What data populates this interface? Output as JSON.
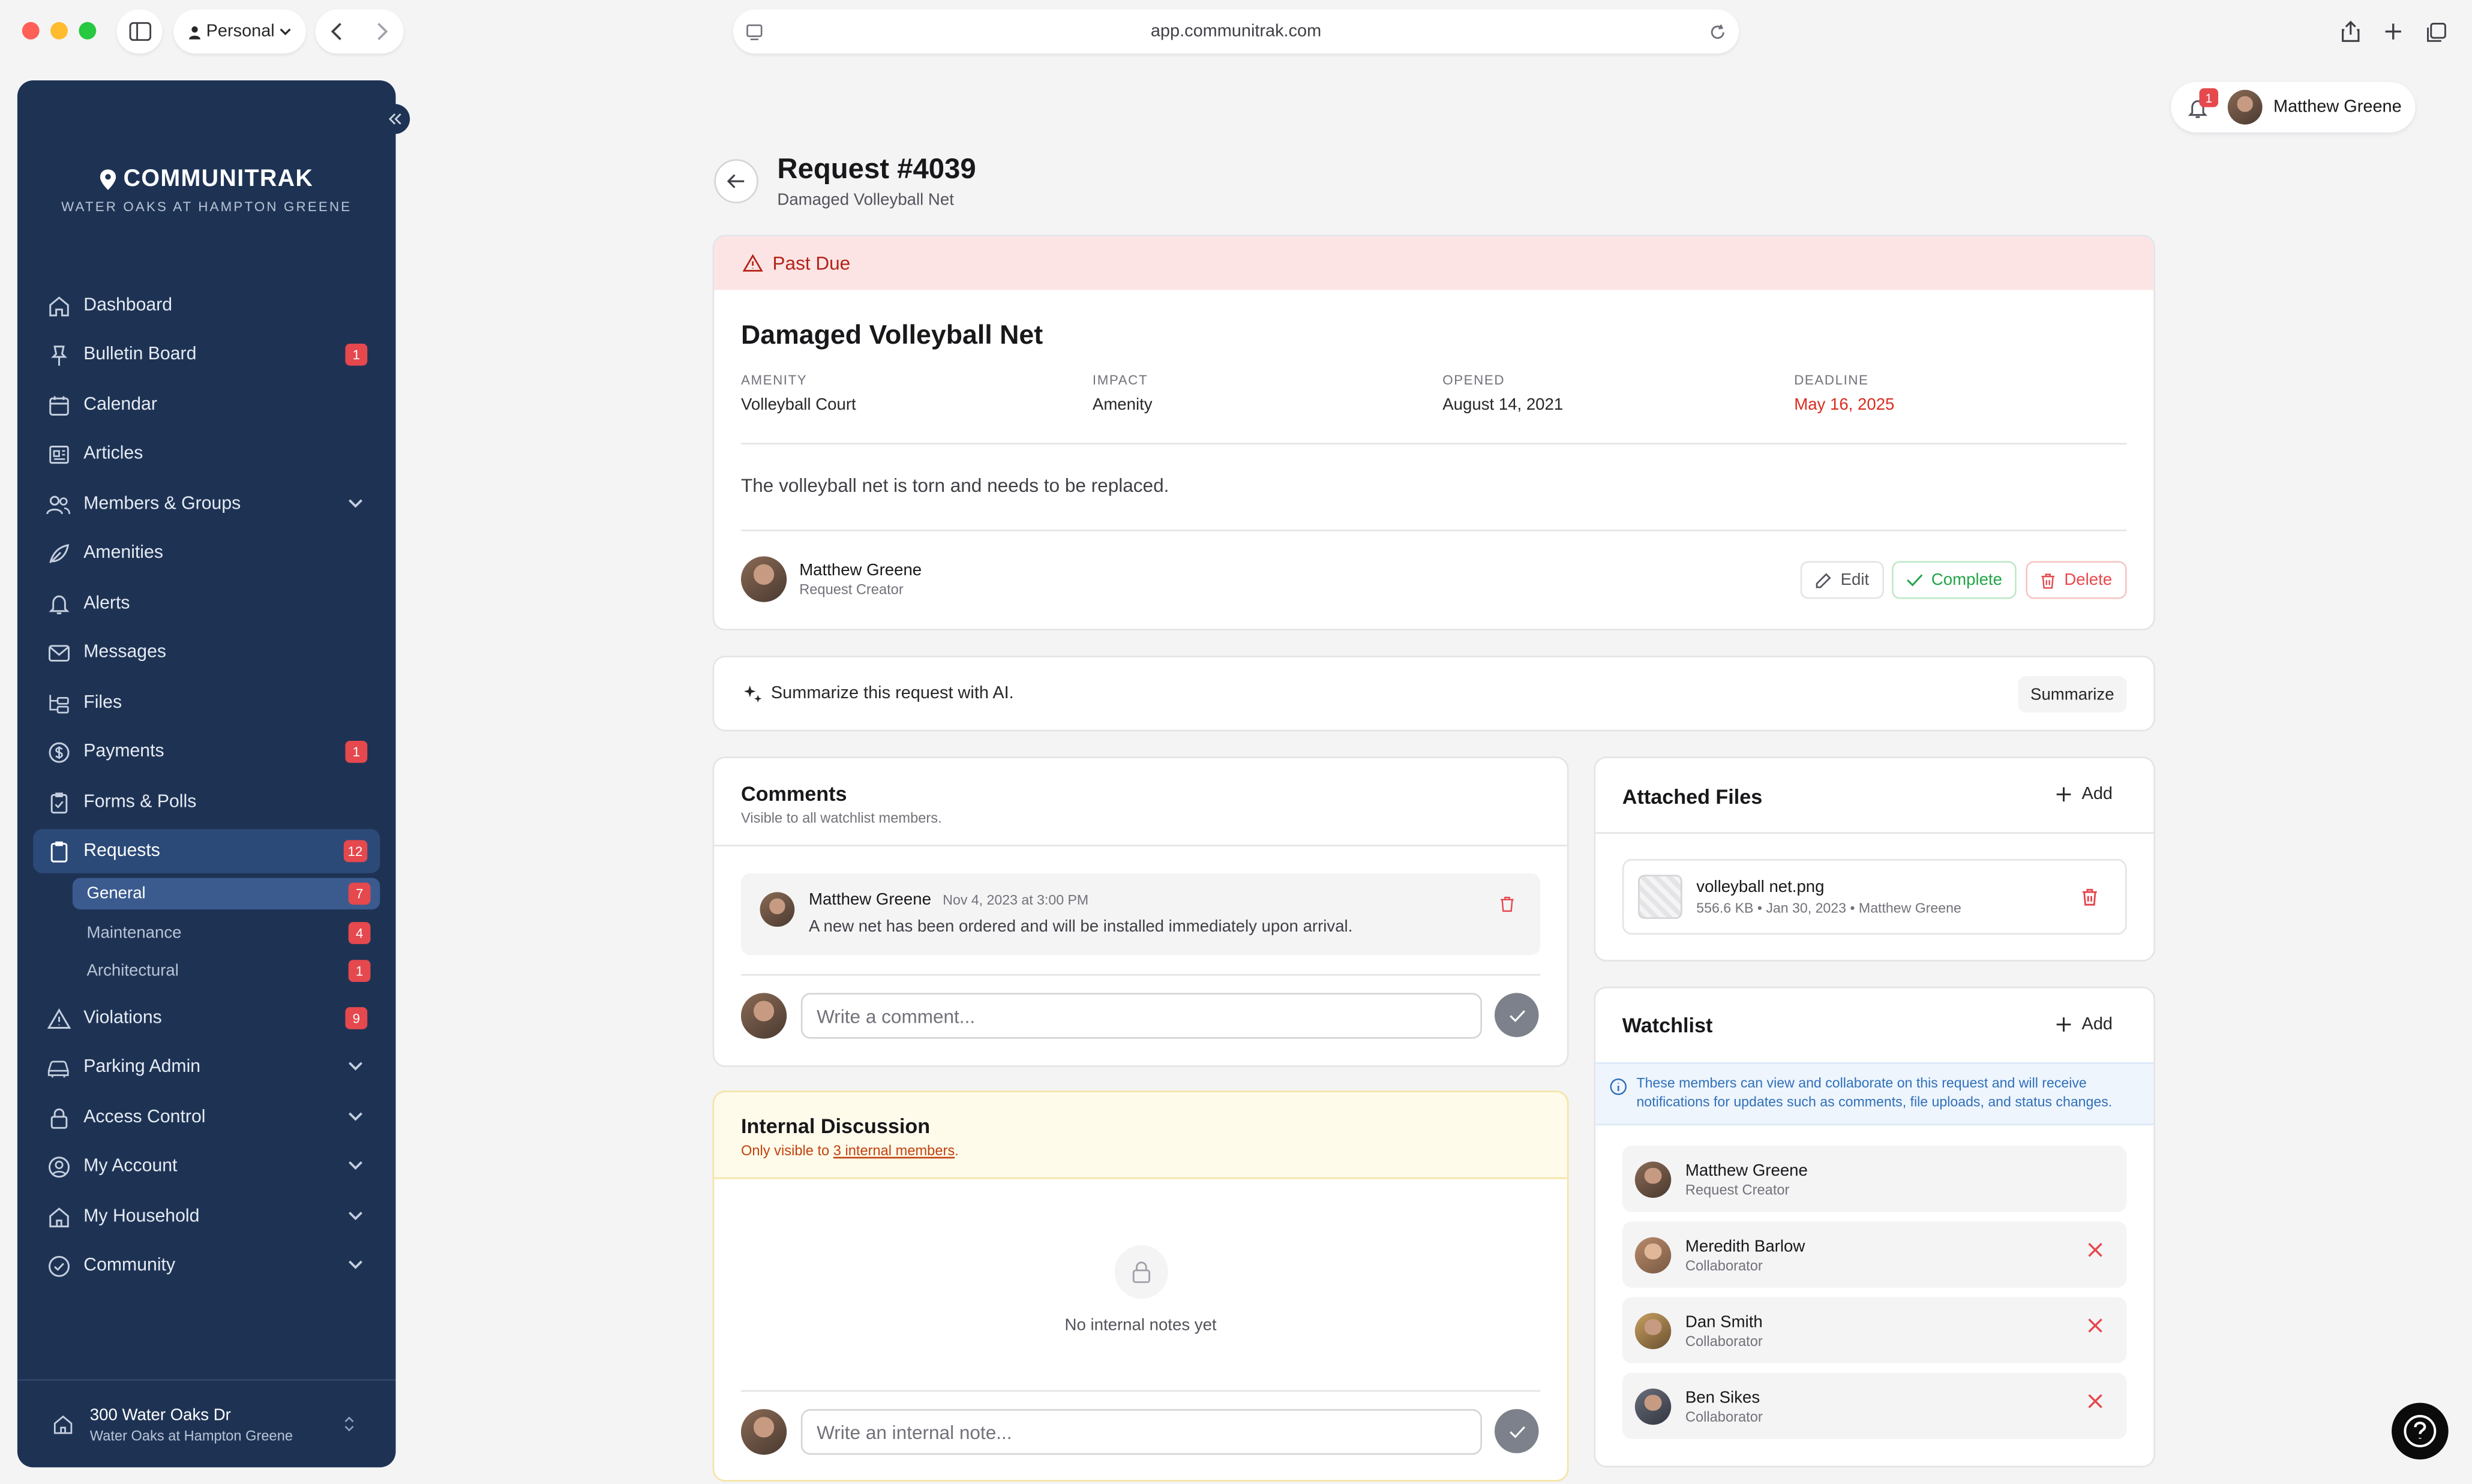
{
  "browser": {
    "profile_label": "Personal",
    "url": "app.communitrak.com"
  },
  "brand": {
    "name": "COMMUNITRAK",
    "subtitle": "WATER OAKS AT HAMPTON GREENE"
  },
  "sidebar": {
    "items": [
      {
        "label": "Dashboard",
        "icon": "home-icon"
      },
      {
        "label": "Bulletin Board",
        "icon": "pin-icon",
        "badge": "1"
      },
      {
        "label": "Calendar",
        "icon": "calendar-icon"
      },
      {
        "label": "Articles",
        "icon": "newspaper-icon"
      },
      {
        "label": "Members & Groups",
        "icon": "users-icon"
      },
      {
        "label": "Amenities",
        "icon": "leaf-icon"
      },
      {
        "label": "Alerts",
        "icon": "bell-icon"
      },
      {
        "label": "Messages",
        "icon": "mail-icon"
      },
      {
        "label": "Files",
        "icon": "folder-tree-icon"
      },
      {
        "label": "Payments",
        "icon": "dollar-icon",
        "badge": "1"
      },
      {
        "label": "Forms & Polls",
        "icon": "clipboard-check-icon"
      },
      {
        "label": "Requests",
        "icon": "clipboard-icon",
        "badge": "12"
      },
      {
        "label": "Violations",
        "icon": "warning-icon",
        "badge": "9"
      },
      {
        "label": "Parking Admin",
        "icon": "car-icon"
      },
      {
        "label": "Access Control",
        "icon": "lock-icon"
      },
      {
        "label": "My Account",
        "icon": "user-circle-icon"
      },
      {
        "label": "My Household",
        "icon": "house-icon"
      },
      {
        "label": "Community",
        "icon": "check-circle-icon"
      }
    ],
    "request_sub": [
      {
        "label": "General",
        "badge": "7"
      },
      {
        "label": "Maintenance",
        "badge": "4"
      },
      {
        "label": "Architectural",
        "badge": "1"
      }
    ],
    "footer": {
      "address": "300 Water Oaks Dr",
      "community": "Water Oaks at Hampton Greene"
    }
  },
  "user": {
    "name": "Matthew Greene",
    "notification_count": "1"
  },
  "request": {
    "heading": "Request #4039",
    "subheading": "Damaged Volleyball Net",
    "status_banner": "Past Due",
    "title": "Damaged Volleyball Net",
    "meta": [
      {
        "key": "AMENITY",
        "value": "Volleyball Court"
      },
      {
        "key": "IMPACT",
        "value": "Amenity"
      },
      {
        "key": "OPENED",
        "value": "August 14, 2021"
      },
      {
        "key": "DEADLINE",
        "value": "May 16, 2025"
      }
    ],
    "description": "The volleyball net is torn and needs to be replaced.",
    "creator": {
      "name": "Matthew Greene",
      "role": "Request Creator"
    },
    "actions": {
      "edit": "Edit",
      "complete": "Complete",
      "delete": "Delete"
    }
  },
  "ai": {
    "prompt": "Summarize this request with AI.",
    "button": "Summarize"
  },
  "comments": {
    "title": "Comments",
    "subtitle": "Visible to all watchlist members.",
    "items": [
      {
        "author": "Matthew Greene",
        "time": "Nov 4, 2023 at 3:00 PM",
        "text": "A new net has been ordered and will be installed immediately upon arrival."
      }
    ],
    "placeholder": "Write a comment..."
  },
  "internal": {
    "title": "Internal Discussion",
    "subtitle_prefix": "Only visible to ",
    "subtitle_link": "3 internal members",
    "subtitle_suffix": ".",
    "empty": "No internal notes yet",
    "placeholder": "Write an internal note..."
  },
  "files": {
    "title": "Attached Files",
    "add": "Add",
    "items": [
      {
        "name": "volleyball net.png",
        "meta": "556.6 KB • Jan 30, 2023 • Matthew Greene"
      }
    ]
  },
  "watchlist": {
    "title": "Watchlist",
    "add": "Add",
    "info": "These members can view and collaborate on this request and will receive notifications for updates such as comments, file uploads, and status changes.",
    "members": [
      {
        "name": "Matthew Greene",
        "role": "Request Creator"
      },
      {
        "name": "Meredith Barlow",
        "role": "Collaborator"
      },
      {
        "name": "Dan Smith",
        "role": "Collaborator"
      },
      {
        "name": "Ben Sikes",
        "role": "Collaborator"
      }
    ]
  },
  "colors": {
    "sidebar_bg": "#1e3354",
    "accent_red": "#e5484d",
    "complete_green": "#22a447",
    "info_blue": "#2f6fb9"
  }
}
